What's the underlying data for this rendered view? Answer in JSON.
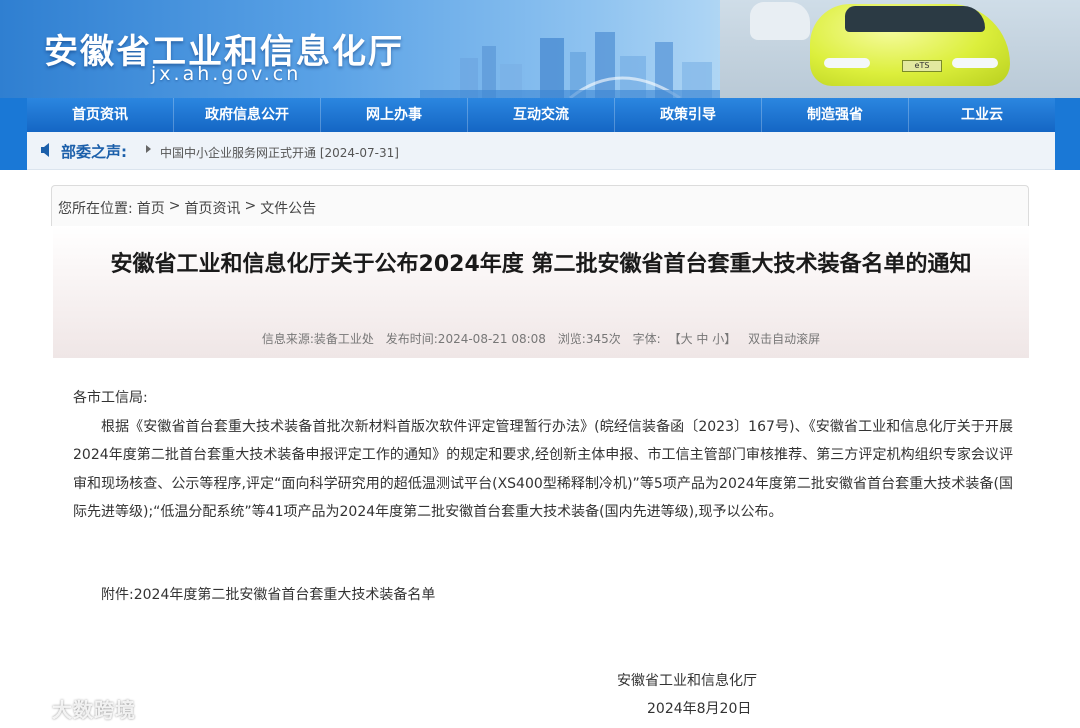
{
  "header": {
    "site_title": "安徽省工业和信息化厅",
    "site_domain": "jx.ah.gov.cn",
    "car_plate": "eTS"
  },
  "nav": {
    "items": [
      "首页资讯",
      "政府信息公开",
      "网上办事",
      "互动交流",
      "政策引导",
      "制造强省",
      "工业云"
    ]
  },
  "notice": {
    "label": "部委之声:",
    "text": "中国中小企业服务网正式开通 [2024-07-31]"
  },
  "breadcrumb": {
    "prefix": "您所在位置:",
    "items": [
      "首页",
      "首页资讯",
      "文件公告"
    ],
    "separator": ">"
  },
  "article": {
    "title": "安徽省工业和信息化厅关于公布2024年度 第二批安徽省首台套重大技术装备名单的通知",
    "meta": {
      "source": "信息来源:装备工业处",
      "published": "发布时间:2024-08-21 08:08",
      "views": "浏览:345次",
      "font_label": "字体:",
      "font_sizes": "【大 中 小】",
      "autoscroll": "双击自动滚屏"
    },
    "salutation": "各市工信局:",
    "paragraph": "根据《安徽省首台套重大技术装备首批次新材料首版次软件评定管理暂行办法》(皖经信装备函〔2023〕167号)、《安徽省工业和信息化厅关于开展2024年度第二批首台套重大技术装备申报评定工作的通知》的规定和要求,经创新主体申报、市工信主管部门审核推荐、第三方评定机构组织专家会议评审和现场核查、公示等程序,评定“面向科学研究用的超低温测试平台(XS400型稀释制冷机)”等5项产品为2024年度第二批安徽省首台套重大技术装备(国际先进等级);“低温分配系统”等41项产品为2024年度第二批安徽首台套重大技术装备(国内先进等级),现予以公布。",
    "attachment": "附件:2024年度第二批安徽省首台套重大技术装备名单",
    "signature_org": "安徽省工业和信息化厅",
    "signature_date": "2024年8月20日"
  },
  "watermark": {
    "text": "大数跨境"
  },
  "colors": {
    "nav_blue": "#1466c4",
    "notice_label": "#1b5faa",
    "banner_start": "#2f7fd1"
  }
}
